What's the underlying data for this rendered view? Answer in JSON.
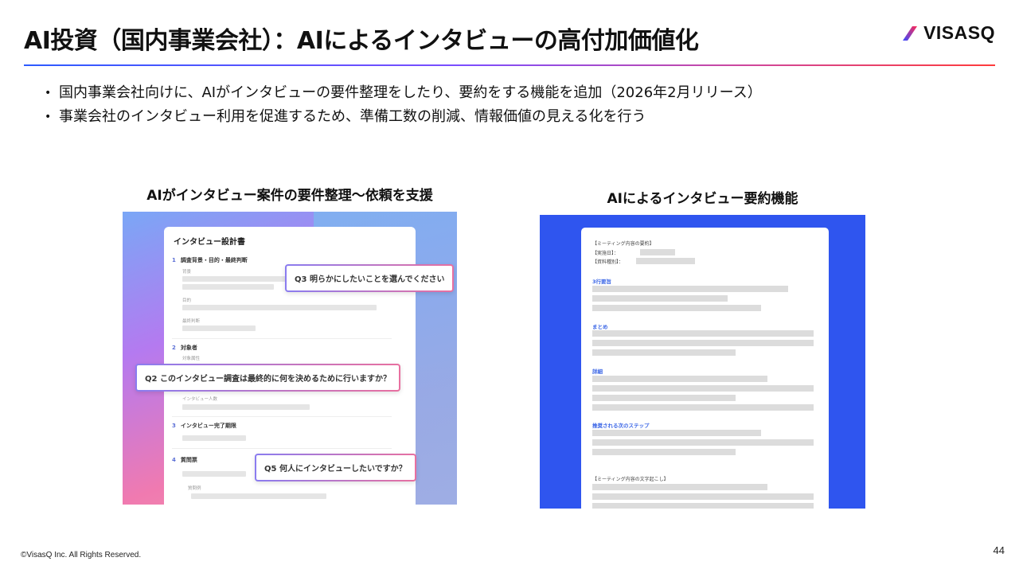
{
  "slide": {
    "title": "AI投資（国内事業会社）：AIによるインタビューの高付加価値化",
    "brand": "VISASQ",
    "bullets": [
      "国内事業会社向けに、AIがインタビューの要件整理をしたり、要約をする機能を追加（2026年2月リリース）",
      "事業会社のインタビュー利用を促進するため、準備工数の削減、情報価値の見える化を行う"
    ],
    "footer": "©VisasQ Inc. All Rights Reserved.",
    "page_number": "44"
  },
  "left": {
    "caption": "AIがインタビュー案件の要件整理〜依頼を支援",
    "form_title": "インタビュー設計書",
    "sections": [
      {
        "num": "1",
        "label": "調査背景・目的・最終判断"
      },
      {
        "num": "2",
        "label": "対象者"
      },
      {
        "num": "3",
        "label": "インタビュー完了期限"
      },
      {
        "num": "4",
        "label": "質問票"
      }
    ],
    "sublabels": [
      "背景",
      "目的",
      "最終判断",
      "対象属性",
      "インタビュー人数",
      "質問例"
    ],
    "callouts": [
      "Q3  明らかにしたいことを選んでください",
      "Q2  このインタビュー調査は最終的に何を決めるために行いますか？",
      "Q5  何人にインタビューしたいですか？"
    ]
  },
  "right": {
    "caption": "AIによるインタビュー要約機能",
    "doc_header": "【ミーティング内容の要約】",
    "date_label": "【実施日】：",
    "type_label": "【資料種別】：",
    "sections": [
      "3行要旨",
      "まとめ",
      "詳細",
      "推奨される次のステップ"
    ],
    "transcript_header": "【ミーティング内容の文字起こし】"
  },
  "colors": {
    "rule_start": "#2d5bff",
    "rule_end": "#ff3b3b",
    "right_panel_bg": "#2f55ef",
    "section_heading": "#3b66e6"
  }
}
